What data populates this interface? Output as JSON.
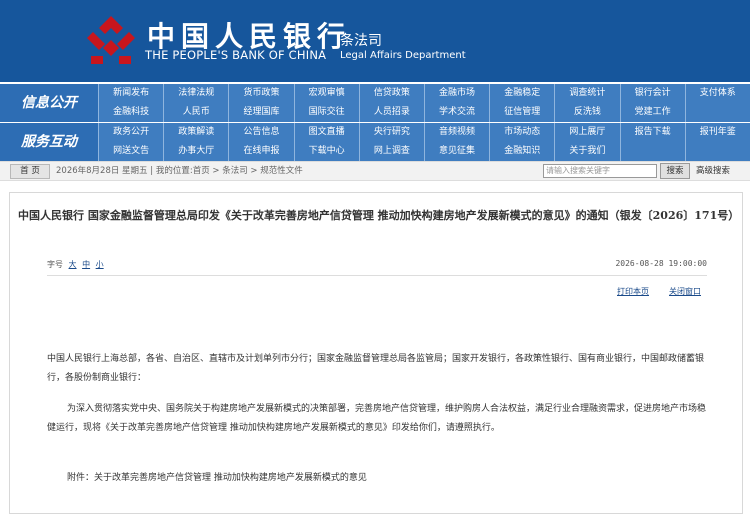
{
  "header": {
    "bank_name_zh": "中国人民银行",
    "bank_name_en": "THE PEOPLE'S BANK OF CHINA",
    "dept_zh": "条法司",
    "dept_en": "Legal Affairs Department",
    "bg_color": "#16569c",
    "logo_color": "#c8161d",
    "logo_icon": "pboc-logo-icon"
  },
  "nav": {
    "info_label": "信息公开",
    "service_label": "服务互动",
    "info_items": [
      "新闻发布",
      "法律法规",
      "货币政策",
      "宏观审慎",
      "信贷政策",
      "金融市场",
      "金融稳定",
      "调查统计",
      "银行会计",
      "支付体系",
      "金融科技",
      "人民币",
      "经理国库",
      "国际交往",
      "人员招录",
      "学术交流",
      "征信管理",
      "反洗钱",
      "党建工作",
      ""
    ],
    "service_items": [
      "政务公开",
      "政策解读",
      "公告信息",
      "图文直播",
      "央行研究",
      "音频视频",
      "市场动态",
      "网上展厅",
      "报告下载",
      "报刊年鉴",
      "网送文告",
      "办事大厅",
      "在线申报",
      "下载中心",
      "网上调查",
      "意见征集",
      "金融知识",
      "关于我们",
      "",
      ""
    ]
  },
  "breadcrumb": {
    "home": "首 页",
    "date_text": "2026年8月28日 星期五",
    "location": "| 我的位置:首页 > 条法司 > 规范性文件",
    "search_placeholder": "请输入搜索关键字",
    "search_button": "搜索",
    "advanced": "高级搜索"
  },
  "article": {
    "title": "中国人民银行 国家金融监督管理总局印发《关于改革完善房地产信贷管理 推动加快构建房地产发展新模式的意见》的通知（银发〔2026〕171号）",
    "font_label": "字号",
    "font_options": [
      "大",
      "中",
      "小"
    ],
    "date": "2026-08-28 19:00:00",
    "print": "打印本页",
    "close": "关闭窗口",
    "p1": "中国人民银行上海总部，各省、自治区、直辖市及计划单列市分行；国家金融监督管理总局各监管局；国家开发银行，各政策性银行、国有商业银行，中国邮政储蓄银行，各股份制商业银行：",
    "p2": "为深入贯彻落实党中央、国务院关于构建房地产发展新模式的决策部署，完善房地产信贷管理，维护购房人合法权益，满足行业合理融资需求，促进房地产市场稳健运行，现将《关于改革完善房地产信贷管理 推动加快构建房地产发展新模式的意见》印发给你们，请遵照执行。",
    "p3": "附件：关于改革完善房地产信贷管理 推动加快构建房地产发展新模式的意见"
  }
}
